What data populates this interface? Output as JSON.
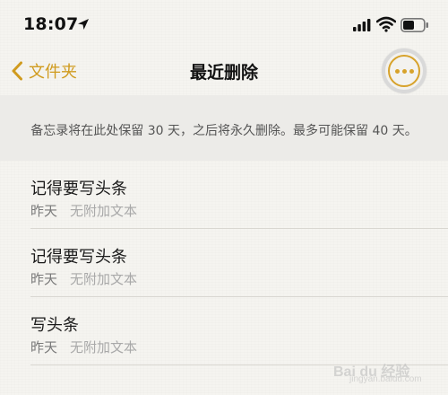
{
  "status_bar": {
    "time": "18:07",
    "icons": [
      "location-icon",
      "signal-icon",
      "wifi-icon",
      "battery-icon"
    ]
  },
  "nav": {
    "back_label": "文件夹",
    "title": "最近删除",
    "more_icon": "more-icon"
  },
  "banner": {
    "text": "备忘录将在此处保留 30 天，之后将永久删除。最多可能保留 40 天。"
  },
  "notes": [
    {
      "title": "记得要写头条",
      "date": "昨天",
      "preview": "无附加文本"
    },
    {
      "title": "记得要写头条",
      "date": "昨天",
      "preview": "无附加文本"
    },
    {
      "title": "写头条",
      "date": "昨天",
      "preview": "无附加文本"
    }
  ],
  "watermark": {
    "brand": "Bai du 经验",
    "sub": "jingyan.baidu.com"
  },
  "colors": {
    "accent": "#d09b1e",
    "more_button_ring": "#d7a22b",
    "background": "#f5f4f0",
    "banner_bg": "#ecebe8"
  }
}
